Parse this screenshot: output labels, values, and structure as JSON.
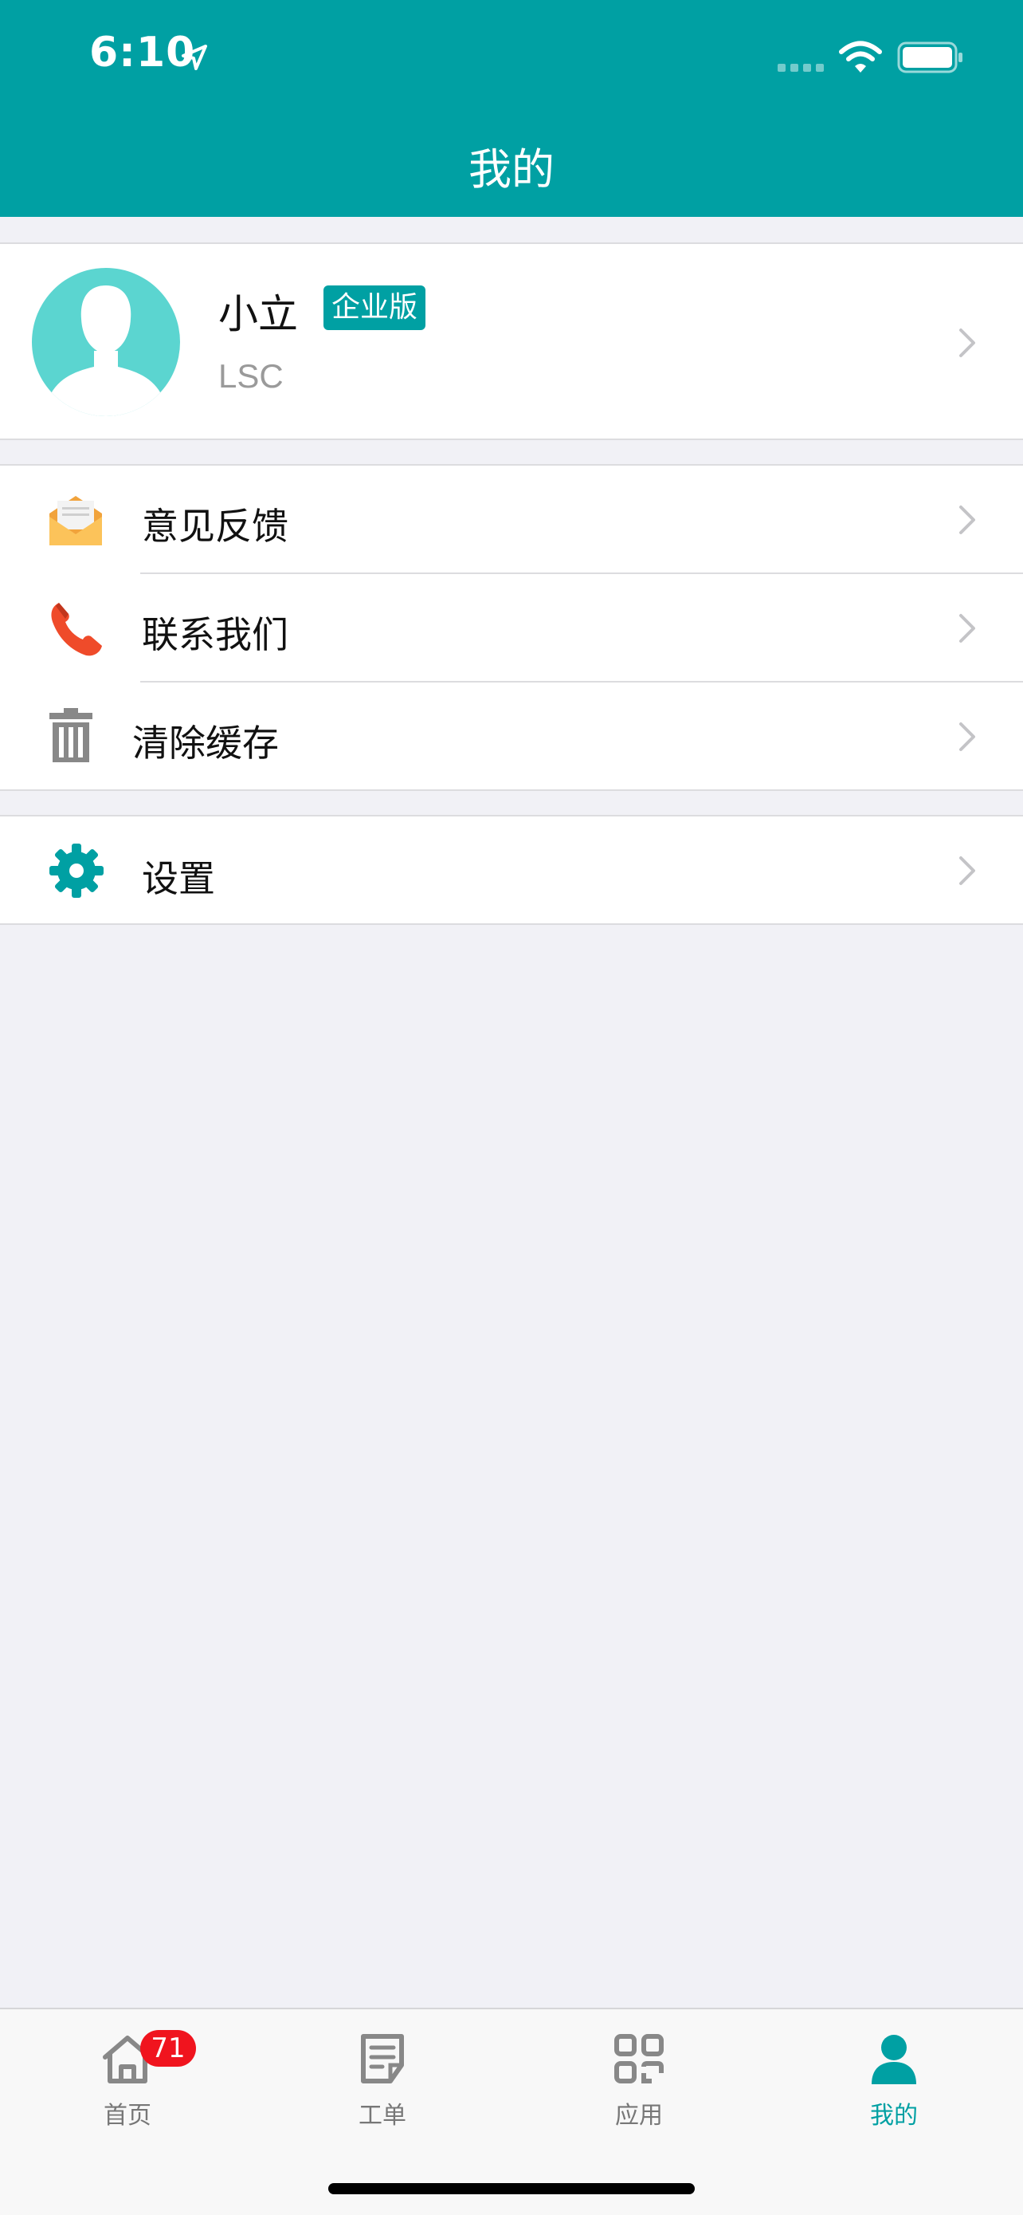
{
  "status": {
    "time": "6:10"
  },
  "header": {
    "title": "我的"
  },
  "profile": {
    "name": "小立",
    "edition": "企业版",
    "org": "LSC"
  },
  "menu": {
    "items": [
      {
        "label": "意见反馈",
        "icon": "feedback-envelope-icon"
      },
      {
        "label": "联系我们",
        "icon": "phone-icon"
      },
      {
        "label": "清除缓存",
        "icon": "trash-icon"
      }
    ]
  },
  "settings": {
    "label": "设置",
    "icon": "gear-icon"
  },
  "tabs": [
    {
      "label": "首页",
      "icon": "home-icon",
      "badge": "71"
    },
    {
      "label": "工单",
      "icon": "work-order-icon"
    },
    {
      "label": "应用",
      "icon": "apps-grid-icon"
    },
    {
      "label": "我的",
      "icon": "person-icon",
      "active": true
    }
  ],
  "colors": {
    "primary": "#00a0a3",
    "badge": "#f0141e",
    "background": "#f1f1f6"
  }
}
